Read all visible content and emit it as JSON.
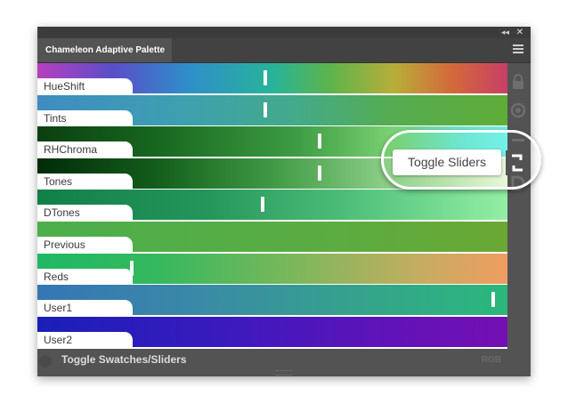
{
  "window": {
    "collapse_icon": "double-chevron-left",
    "close_icon": "x",
    "menu_icon": "hamburger"
  },
  "tab": {
    "title": "Chameleon Adaptive Palette"
  },
  "rows": [
    {
      "label": "HueShift",
      "handle_fraction": 0.485,
      "gradient": "linear-gradient(90deg,#b63fbf 0%,#5a4ec9 16%,#2f8ec9 32%,#28b39a 50%,#5cb44c 62%,#b8ad39 76%,#d36a3a 88%,#c73f66 100%)"
    },
    {
      "label": "Tints",
      "handle_fraction": 0.485,
      "gradient": "linear-gradient(90deg,#3f8cc2 0%,#3d9fb0 30%,#43aa8a 55%,#55ac52 75%,#5fac38 100%)"
    },
    {
      "label": "RHChroma",
      "handle_fraction": 0.6,
      "gradient": "linear-gradient(90deg,#0b3f11 0%,#17661f 25%,#3d9c43 55%,#79d071 75%,#6ee6d0 90%,#73f0e8 100%)"
    },
    {
      "label": "Tones",
      "handle_fraction": 0.6,
      "gradient": "linear-gradient(90deg,#022b07 0%,#125d1a 25%,#3f9a45 50%,#8fd089 75%,#e8f7d8 100%)"
    },
    {
      "label": "DTones",
      "handle_fraction": 0.48,
      "gradient": "linear-gradient(90deg,#118047 0%,#24955a 35%,#4cbd78 65%,#93efa4 100%)"
    },
    {
      "label": "Previous",
      "handle_fraction": null,
      "gradient": "linear-gradient(90deg,#4caf4b 0%,#5aac42 60%,#6aa834 100%)"
    },
    {
      "label": "Reds",
      "handle_fraction": 0.2,
      "gradient": "linear-gradient(90deg,#1fb866 0%,#35b85e 25%,#7db75b 55%,#c1ae61 80%,#f09d61 100%)"
    },
    {
      "label": "User1",
      "handle_fraction": 0.97,
      "gradient": "linear-gradient(90deg,#3576b4 0%,#3a8aa6 35%,#35a48a 70%,#2bb77c 100%)"
    },
    {
      "label": "User2",
      "handle_fraction": null,
      "gradient": "linear-gradient(90deg,#1a1fb8 0%,#3a1abd 40%,#6013b8 75%,#7410b3 100%)"
    }
  ],
  "side_icons": [
    "lock-icon",
    "target-icon",
    "dash-icon",
    "toggle-sliders-icon",
    "d-icon"
  ],
  "footer": {
    "label": "Toggle Swatches/Sliders",
    "mode": "RGB"
  },
  "callout": {
    "label": "Toggle Sliders"
  }
}
